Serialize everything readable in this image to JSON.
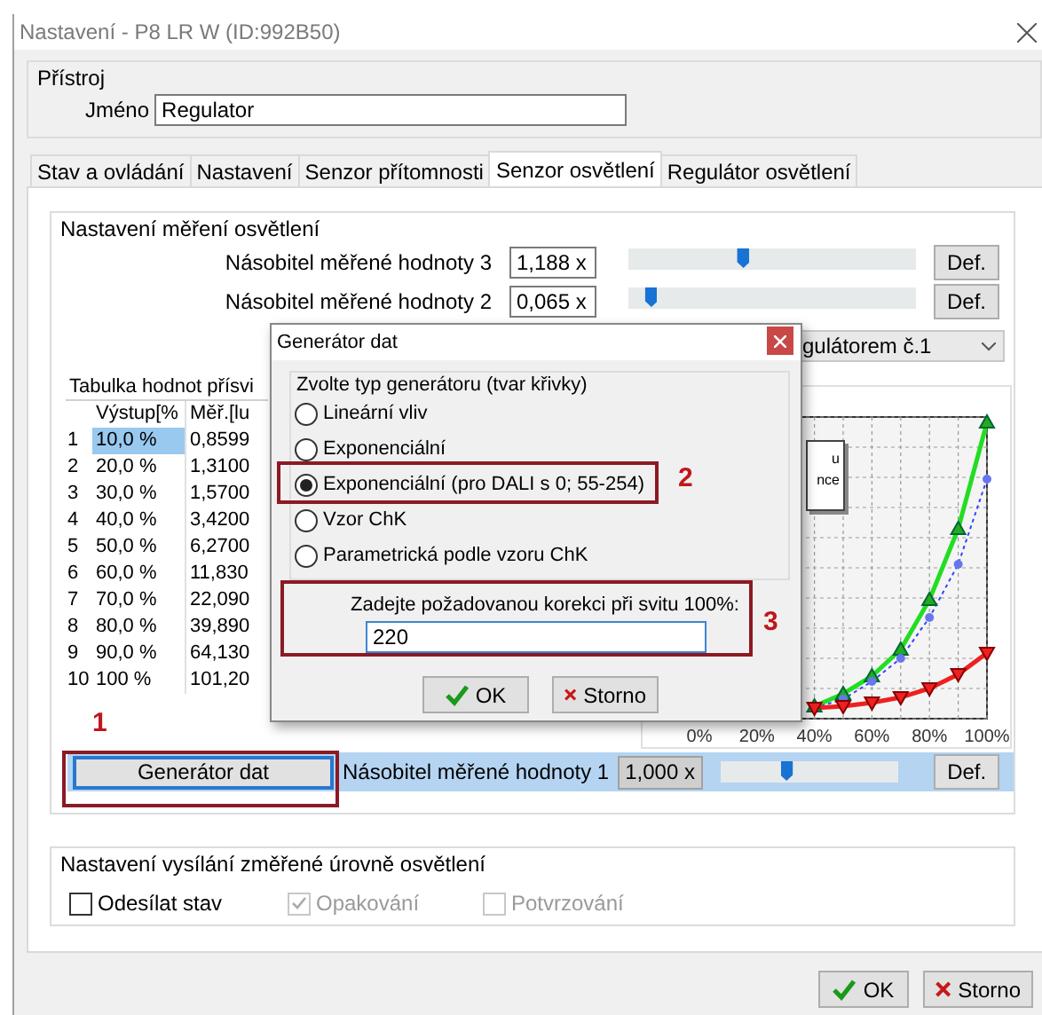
{
  "window": {
    "title": "Nastavení - P8 LR W (ID:992B50)"
  },
  "device": {
    "title": "Přístroj",
    "name_label": "Jméno",
    "name_value": "Regulator"
  },
  "tabs": [
    {
      "label": "Stav a ovládání",
      "selected": false
    },
    {
      "label": "Nastavení",
      "selected": false
    },
    {
      "label": "Senzor přítomnosti",
      "selected": false
    },
    {
      "label": "Senzor osvětlení",
      "selected": true
    },
    {
      "label": "Regulátor osvětlení",
      "selected": false
    }
  ],
  "measurement": {
    "title": "Nastavení měření osvětlení",
    "multipliers": [
      {
        "label": "Násobitel měřené hodnoty 3",
        "value": "1,188 x",
        "level": 0.4,
        "button": "Def."
      },
      {
        "label": "Násobitel měřené hodnoty 2",
        "value": "0,065 x",
        "level": 0.08,
        "button": "Def."
      }
    ],
    "dropdown": {
      "value": "gulátorem č.1"
    },
    "table": {
      "title": "Tabulka hodnot přísvi",
      "columns": [
        "Výstup[%",
        "Měř.[lu"
      ],
      "rows": [
        {
          "index": "1",
          "cells": [
            "10,0 %",
            "0,8599"
          ],
          "selected": true
        },
        {
          "index": "2",
          "cells": [
            "20,0 %",
            "1,3100"
          ],
          "selected": false
        },
        {
          "index": "3",
          "cells": [
            "30,0 %",
            "1,5700"
          ],
          "selected": false
        },
        {
          "index": "4",
          "cells": [
            "40,0 %",
            "3,4200"
          ],
          "selected": false
        },
        {
          "index": "5",
          "cells": [
            "50,0 %",
            "6,2700"
          ],
          "selected": false
        },
        {
          "index": "6",
          "cells": [
            "60,0 %",
            "11,830"
          ],
          "selected": false
        },
        {
          "index": "7",
          "cells": [
            "70,0 %",
            "22,090"
          ],
          "selected": false
        },
        {
          "index": "8",
          "cells": [
            "80,0 %",
            "39,890"
          ],
          "selected": false
        },
        {
          "index": "9",
          "cells": [
            "90,0 %",
            "64,130"
          ],
          "selected": false
        },
        {
          "index": "10",
          "cells": [
            "100 %",
            "101,20"
          ],
          "selected": false
        }
      ]
    },
    "chart": {
      "legend": [
        "u",
        "nce"
      ],
      "x_labels": [
        "0%",
        "20%",
        "40%",
        "60%",
        "80%",
        "100%"
      ]
    },
    "generator_row": {
      "button": "Generátor dat",
      "label": "Násobitel měřené hodnoty 1",
      "value": "1,000 x",
      "level": 0.37,
      "def_button": "Def."
    }
  },
  "broadcast": {
    "title": "Nastavení vysílání změřené úrovně osvětlení",
    "checkboxes": [
      {
        "label": "Odesílat stav",
        "checked": false,
        "disabled": false
      },
      {
        "label": "Opakování",
        "checked": true,
        "disabled": true
      },
      {
        "label": "Potvrzování",
        "checked": false,
        "disabled": true
      }
    ]
  },
  "buttons": [
    {
      "label": "OK",
      "kind": "ok"
    },
    {
      "label": "Storno",
      "kind": "cancel"
    }
  ],
  "dialog": {
    "title": "Generátor dat",
    "group_title": "Zvolte typ generátoru (tvar křivky)",
    "options": [
      {
        "label": "Lineární vliv",
        "selected": false
      },
      {
        "label": "Exponenciální",
        "selected": false
      },
      {
        "label": "Exponenciální (pro DALI s 0; 55-254)",
        "selected": true
      },
      {
        "label": "Vzor ChK",
        "selected": false
      },
      {
        "label": "Parametrická podle vzoru ChK",
        "selected": false
      }
    ],
    "prompt": "Zadejte požadovanou korekci při svitu 100%:",
    "value": "220",
    "buttons": [
      {
        "label": "OK",
        "kind": "ok"
      },
      {
        "label": "Storno",
        "kind": "cancel"
      }
    ]
  },
  "annotations": [
    {
      "label": "1"
    },
    {
      "label": "2"
    },
    {
      "label": "3"
    }
  ]
}
